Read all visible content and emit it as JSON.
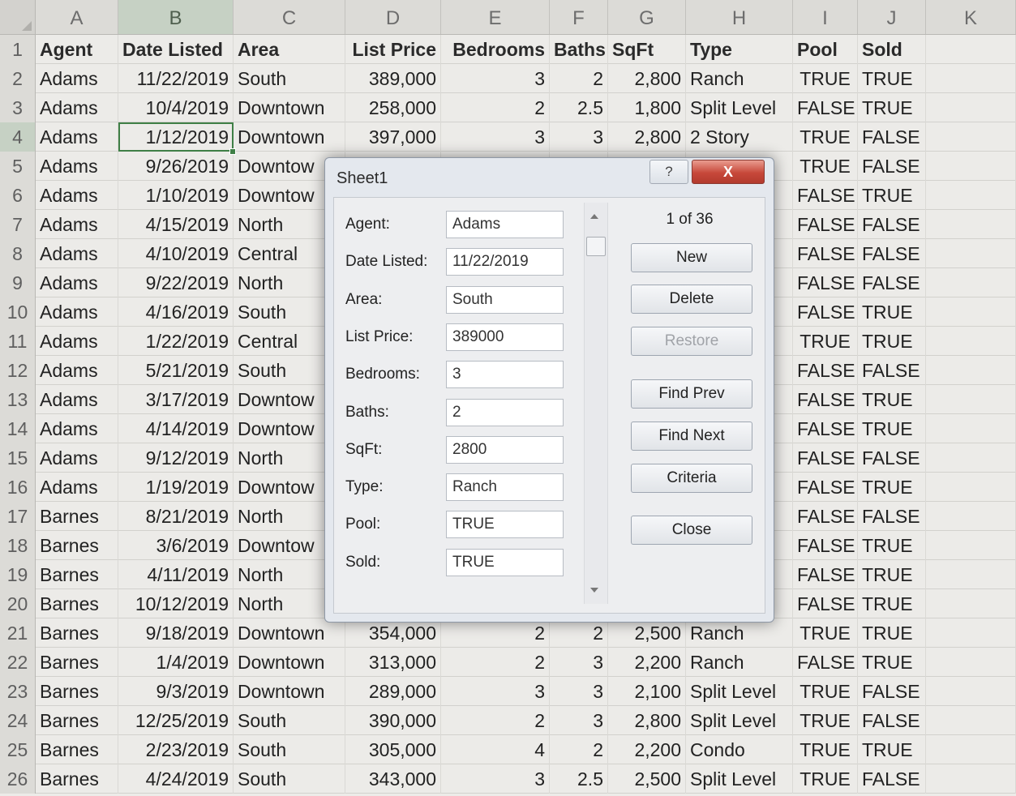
{
  "columns": [
    "A",
    "B",
    "C",
    "D",
    "E",
    "F",
    "G",
    "H",
    "I",
    "J",
    "K"
  ],
  "rows": [
    {
      "n": "1",
      "cells": [
        "Agent",
        "Date Listed",
        "Area",
        "List Price",
        "Bedrooms",
        "Baths",
        "SqFt",
        "Type",
        "Pool",
        "Sold"
      ]
    },
    {
      "n": "2",
      "cells": [
        "Adams",
        "11/22/2019",
        "South",
        "389,000",
        "3",
        "2",
        "2,800",
        "Ranch",
        "TRUE",
        "TRUE"
      ]
    },
    {
      "n": "3",
      "cells": [
        "Adams",
        "10/4/2019",
        "Downtown",
        "258,000",
        "2",
        "2.5",
        "1,800",
        "Split Level",
        "FALSE",
        "TRUE"
      ]
    },
    {
      "n": "4",
      "cells": [
        "Adams",
        "1/12/2019",
        "Downtown",
        "397,000",
        "3",
        "3",
        "2,800",
        "2 Story",
        "TRUE",
        "FALSE"
      ]
    },
    {
      "n": "5",
      "cells": [
        "Adams",
        "9/26/2019",
        "Downtow",
        "",
        "",
        "",
        "",
        "",
        "TRUE",
        "FALSE"
      ]
    },
    {
      "n": "6",
      "cells": [
        "Adams",
        "1/10/2019",
        "Downtow",
        "",
        "",
        "",
        "",
        "",
        "FALSE",
        "TRUE"
      ]
    },
    {
      "n": "7",
      "cells": [
        "Adams",
        "4/15/2019",
        "North",
        "",
        "",
        "",
        "",
        "",
        "FALSE",
        "FALSE"
      ]
    },
    {
      "n": "8",
      "cells": [
        "Adams",
        "4/10/2019",
        "Central",
        "",
        "",
        "",
        "",
        "",
        "FALSE",
        "FALSE"
      ]
    },
    {
      "n": "9",
      "cells": [
        "Adams",
        "9/22/2019",
        "North",
        "",
        "",
        "",
        "",
        "",
        "FALSE",
        "FALSE"
      ]
    },
    {
      "n": "10",
      "cells": [
        "Adams",
        "4/16/2019",
        "South",
        "",
        "",
        "",
        "",
        "",
        "FALSE",
        "TRUE"
      ]
    },
    {
      "n": "11",
      "cells": [
        "Adams",
        "1/22/2019",
        "Central",
        "",
        "",
        "",
        "",
        "",
        "TRUE",
        "TRUE"
      ]
    },
    {
      "n": "12",
      "cells": [
        "Adams",
        "5/21/2019",
        "South",
        "",
        "",
        "",
        "",
        "",
        "FALSE",
        "FALSE"
      ]
    },
    {
      "n": "13",
      "cells": [
        "Adams",
        "3/17/2019",
        "Downtow",
        "",
        "",
        "",
        "",
        "",
        "FALSE",
        "TRUE"
      ]
    },
    {
      "n": "14",
      "cells": [
        "Adams",
        "4/14/2019",
        "Downtow",
        "",
        "",
        "",
        "",
        "el",
        "FALSE",
        "TRUE"
      ]
    },
    {
      "n": "15",
      "cells": [
        "Adams",
        "9/12/2019",
        "North",
        "",
        "",
        "",
        "",
        "",
        "FALSE",
        "FALSE"
      ]
    },
    {
      "n": "16",
      "cells": [
        "Adams",
        "1/19/2019",
        "Downtow",
        "",
        "",
        "",
        "",
        "",
        "FALSE",
        "TRUE"
      ]
    },
    {
      "n": "17",
      "cells": [
        "Barnes",
        "8/21/2019",
        "North",
        "",
        "",
        "",
        "",
        "",
        "FALSE",
        "FALSE"
      ]
    },
    {
      "n": "18",
      "cells": [
        "Barnes",
        "3/6/2019",
        "Downtow",
        "",
        "",
        "",
        "",
        "",
        "FALSE",
        "TRUE"
      ]
    },
    {
      "n": "19",
      "cells": [
        "Barnes",
        "4/11/2019",
        "North",
        "",
        "",
        "",
        "",
        "",
        "FALSE",
        "TRUE"
      ]
    },
    {
      "n": "20",
      "cells": [
        "Barnes",
        "10/12/2019",
        "North",
        "",
        "",
        "",
        "",
        "",
        "FALSE",
        "TRUE"
      ]
    },
    {
      "n": "21",
      "cells": [
        "Barnes",
        "9/18/2019",
        "Downtown",
        "354,000",
        "2",
        "2",
        "2,500",
        "Ranch",
        "TRUE",
        "TRUE"
      ]
    },
    {
      "n": "22",
      "cells": [
        "Barnes",
        "1/4/2019",
        "Downtown",
        "313,000",
        "2",
        "3",
        "2,200",
        "Ranch",
        "FALSE",
        "TRUE"
      ]
    },
    {
      "n": "23",
      "cells": [
        "Barnes",
        "9/3/2019",
        "Downtown",
        "289,000",
        "3",
        "3",
        "2,100",
        "Split Level",
        "TRUE",
        "FALSE"
      ]
    },
    {
      "n": "24",
      "cells": [
        "Barnes",
        "12/25/2019",
        "South",
        "390,000",
        "2",
        "3",
        "2,800",
        "Split Level",
        "TRUE",
        "FALSE"
      ]
    },
    {
      "n": "25",
      "cells": [
        "Barnes",
        "2/23/2019",
        "South",
        "305,000",
        "4",
        "2",
        "2,200",
        "Condo",
        "TRUE",
        "TRUE"
      ]
    },
    {
      "n": "26",
      "cells": [
        "Barnes",
        "4/24/2019",
        "South",
        "343,000",
        "3",
        "2.5",
        "2,500",
        "Split Level",
        "TRUE",
        "FALSE"
      ]
    }
  ],
  "dialog": {
    "title": "Sheet1",
    "help_icon": "?",
    "close_icon": "X",
    "record_counter": "1 of 36",
    "fields": [
      {
        "label": "Agent:",
        "value": "Adams"
      },
      {
        "label": "Date Listed:",
        "value": "11/22/2019"
      },
      {
        "label": "Area:",
        "value": "South"
      },
      {
        "label": "List Price:",
        "value": "389000"
      },
      {
        "label": "Bedrooms:",
        "value": "3"
      },
      {
        "label": "Baths:",
        "value": "2"
      },
      {
        "label": "SqFt:",
        "value": "2800"
      },
      {
        "label": "Type:",
        "value": "Ranch"
      },
      {
        "label": "Pool:",
        "value": "TRUE"
      },
      {
        "label": "Sold:",
        "value": "TRUE"
      }
    ],
    "buttons": {
      "new": "New",
      "delete": "Delete",
      "restore": "Restore",
      "find_prev": "Find Prev",
      "find_next": "Find Next",
      "criteria": "Criteria",
      "close": "Close"
    }
  }
}
